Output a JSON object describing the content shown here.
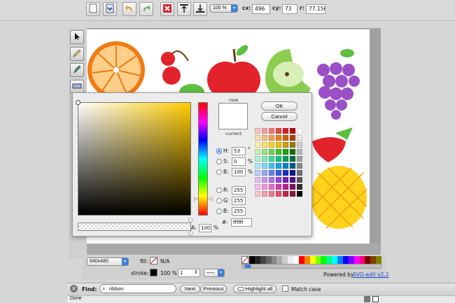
{
  "toolbar": {
    "zoom": "100 %",
    "cx_label": "cx:",
    "cx_value": "496",
    "cy_label": "cy:",
    "cy_value": "73",
    "r_label": "r:",
    "r_value": "77.156"
  },
  "colors": {
    "accent": "#3c7fe0",
    "undo": "#e0a020",
    "redo": "#5db35d",
    "delete": "#d8232a"
  },
  "picker": {
    "new_label": "new",
    "current_label": "current",
    "ok_label": "OK",
    "cancel_label": "Cancel",
    "h_label": "H:",
    "h_value": "53",
    "h_unit": "°",
    "s_label": "S:",
    "s_value": "0",
    "s_unit": "%",
    "b_label": "B:",
    "b_value": "100",
    "b_unit": "%",
    "r_label": "R:",
    "r_value": "255",
    "g_label": "G:",
    "g_value": "255",
    "bb_label": "B:",
    "bb_value": "255",
    "hex_label": "#:",
    "hex_value": "ffffff",
    "alpha_label": "A:",
    "alpha_value": "100",
    "alpha_unit": "%"
  },
  "bottom": {
    "resolution": "640x480",
    "fill_label": "fill:",
    "fill_value": "N/A",
    "stroke_label": "stroke:",
    "stroke_percent": "100 %",
    "stroke_width": "1",
    "powered_by": "Powered by",
    "powered_link": "SVG-edit v2.2"
  },
  "find": {
    "label": "Find:",
    "query": "ribbon",
    "next": "Next",
    "previous": "Previous",
    "highlight": "Highlight all",
    "match_case": "Match case"
  },
  "status": {
    "text": "Done"
  }
}
